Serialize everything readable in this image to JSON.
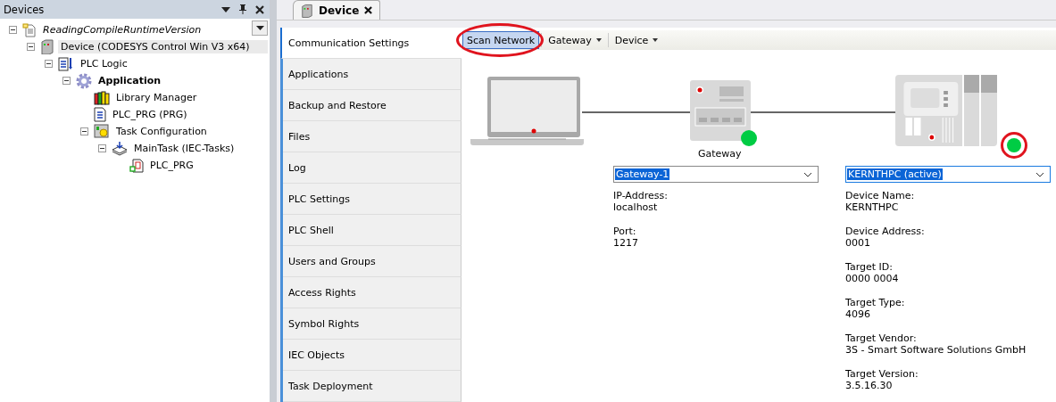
{
  "devices_panel": {
    "title": "Devices",
    "tree": [
      {
        "label": "ReadingCompileRuntimeVersion",
        "kind": "project",
        "expanded": true,
        "selected": false,
        "children": [
          {
            "label": "Device (CODESYS Control Win V3 x64)",
            "kind": "device",
            "expanded": true,
            "selected": true,
            "children": [
              {
                "label": "PLC Logic",
                "kind": "plc-logic",
                "expanded": true,
                "selected": false,
                "children": [
                  {
                    "label": "Application",
                    "kind": "application",
                    "expanded": true,
                    "selected": false,
                    "active": true,
                    "children": [
                      {
                        "label": "Library Manager",
                        "kind": "library",
                        "selected": false
                      },
                      {
                        "label": "PLC_PRG (PRG)",
                        "kind": "pou",
                        "selected": false
                      },
                      {
                        "label": "Task Configuration",
                        "kind": "task-config",
                        "expanded": true,
                        "selected": false,
                        "children": [
                          {
                            "label": "MainTask (IEC-Tasks)",
                            "kind": "task",
                            "expanded": true,
                            "selected": false,
                            "children": [
                              {
                                "label": "PLC_PRG",
                                "kind": "task-call",
                                "selected": false
                              }
                            ]
                          }
                        ]
                      }
                    ]
                  }
                ]
              }
            ]
          }
        ]
      }
    ]
  },
  "editor_tab": {
    "label": "Device"
  },
  "settings_nav": [
    {
      "label": "Communication Settings",
      "selected": true
    },
    {
      "label": "Applications",
      "selected": false
    },
    {
      "label": "Backup and Restore",
      "selected": false
    },
    {
      "label": "Files",
      "selected": false
    },
    {
      "label": "Log",
      "selected": false
    },
    {
      "label": "PLC Settings",
      "selected": false
    },
    {
      "label": "PLC Shell",
      "selected": false
    },
    {
      "label": "Users and Groups",
      "selected": false
    },
    {
      "label": "Access Rights",
      "selected": false
    },
    {
      "label": "Symbol Rights",
      "selected": false
    },
    {
      "label": "IEC Objects",
      "selected": false
    },
    {
      "label": "Task Deployment",
      "selected": false
    }
  ],
  "toolbar": [
    {
      "label": "Scan Network",
      "kind": "button",
      "pressed": true,
      "circled": true
    },
    {
      "label": "Gateway",
      "kind": "menu",
      "pressed": false,
      "circled": false
    },
    {
      "label": "Device",
      "kind": "menu",
      "pressed": false,
      "circled": false
    }
  ],
  "gateway": {
    "label": "Gateway",
    "online": true,
    "combo": "Gateway-1",
    "fields": [
      {
        "label": "IP-Address:",
        "value": "localhost"
      },
      {
        "label": "Port:",
        "value": "1217"
      }
    ]
  },
  "device": {
    "online": true,
    "circled": true,
    "combo": "KERNTHPC (active)",
    "focused": true,
    "fields": [
      {
        "label": "Device Name:",
        "value": "KERNTHPC"
      },
      {
        "label": "Device Address:",
        "value": "0001"
      },
      {
        "label": "Target ID:",
        "value": "0000  0004"
      },
      {
        "label": "Target Type:",
        "value": "4096"
      },
      {
        "label": "Target Vendor:",
        "value": "3S - Smart Software Solutions GmbH"
      },
      {
        "label": "Target Version:",
        "value": "3.5.16.30"
      }
    ]
  }
}
